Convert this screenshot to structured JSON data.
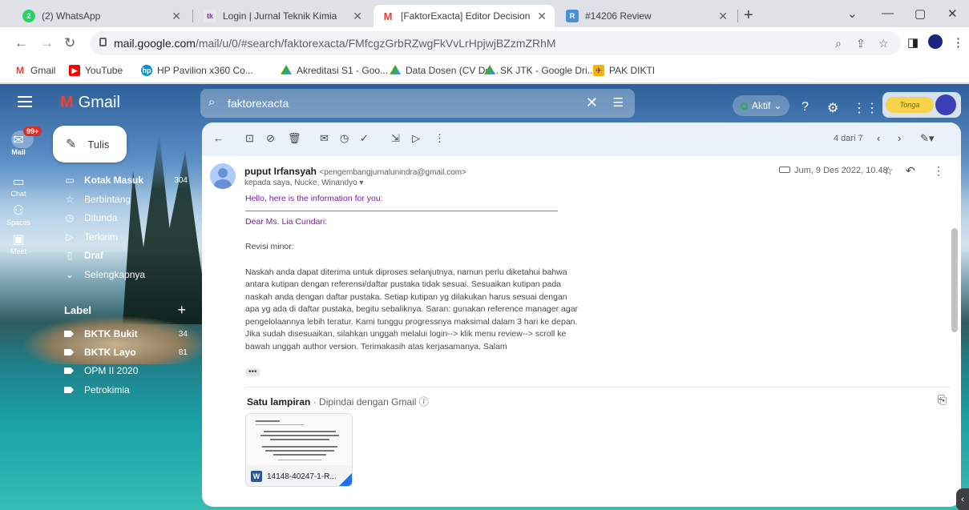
{
  "browser": {
    "tabs": [
      {
        "title": "(2) WhatsApp",
        "icon": "whatsapp-icon",
        "favicon_text": "2"
      },
      {
        "title": "Login | Jurnal Teknik Kimia",
        "icon": "journal-icon",
        "favicon_text": "tk"
      },
      {
        "title": "[FaktorExacta] Editor Decision - I",
        "icon": "gmail-icon",
        "favicon_text": "M"
      },
      {
        "title": "#14206 Review",
        "icon": "review-icon",
        "favicon_text": "R"
      }
    ],
    "new_tab": "+",
    "url_host": "mail.google.com",
    "url_path": "/mail/u/0/#search/faktorexacta/FMfcgzGrbRZwgFkVvLrHpjwjBZzmZRhM",
    "bookmarks": [
      {
        "label": "Gmail",
        "icon": "gmail-icon"
      },
      {
        "label": "YouTube",
        "icon": "youtube-icon"
      },
      {
        "label": "HP Pavilion x360 Co...",
        "icon": "hp-icon"
      },
      {
        "label": "Akreditasi S1 - Goo...",
        "icon": "google-drive-icon"
      },
      {
        "label": "Data Dosen (CV Do...",
        "icon": "google-drive-icon"
      },
      {
        "label": "SK JTK - Google Dri...",
        "icon": "google-drive-icon"
      },
      {
        "label": "PAK DIKTI",
        "icon": "pak-dikti-icon"
      }
    ]
  },
  "gmail": {
    "app_name": "Gmail",
    "search_query": "faktorexacta",
    "status_label": "Aktif",
    "account_badge": "Tonga",
    "avatar_initial": "",
    "rail": [
      {
        "label": "Mail",
        "badge": "99+"
      },
      {
        "label": "Chat"
      },
      {
        "label": "Spaces"
      },
      {
        "label": "Meet"
      }
    ],
    "compose_label": "Tulis",
    "nav": [
      {
        "label": "Kotak Masuk",
        "count": "304",
        "bold": true
      },
      {
        "label": "Berbintang",
        "count": ""
      },
      {
        "label": "Ditunda",
        "count": ""
      },
      {
        "label": "Terkirim",
        "count": ""
      },
      {
        "label": "Draf",
        "count": ""
      },
      {
        "label": "Selengkapnya",
        "count": ""
      }
    ],
    "labels_header": "Label",
    "labels": [
      {
        "label": "BKTK Bukit",
        "count": "34",
        "bold": true
      },
      {
        "label": "BKTK Layo",
        "count": "81",
        "bold": true
      },
      {
        "label": "OPM II 2020",
        "count": ""
      },
      {
        "label": "Petrokimia",
        "count": ""
      }
    ],
    "pager": "4 dari 7"
  },
  "message": {
    "sender_name": "puput Irfansyah",
    "sender_email": "<pengembangjurnalunindra@gmail.com>",
    "recipients": "kepada saya, Nucke, Winandyo",
    "date": "Jum, 9 Des 2022, 10.48",
    "intro": "Hello, here is the information for you:",
    "greeting": "Dear Ms. Lia Cundari:",
    "revision": "Revisi minor:",
    "paragraph": "Naskah anda dapat diterima untuk diproses selanjutnya, namun perlu diketahui bahwa antara kutipan dengan referensi/daftar pustaka tidak sesuai. Sesuaikan kutipan pada naskah anda dengan daftar pustaka. Setiap kutipan yg dilakukan harus sesuai dengan apa yg ada di daftar pustaka, begitu sebaliknya. Saran: gunakan reference manager agar pengelolaannya lebih teratur. Kami tunggu progressnya maksimal dalam 3 hari ke depan. Jika sudah disesuaikan, silahkan unggah melalui login--> klik menu review--> scroll ke bawah unggah author version. Terimakasih atas kerjasamanya. Salam",
    "more": "•••",
    "attachment_header": "Satu lampiran",
    "attachment_scan": "Dipindai dengan Gmail",
    "attachment_name": "14148-40247-1-R...",
    "attachment_type": "W"
  },
  "colors": {
    "gmail_red": "#ea4335",
    "badge_red": "#d93025",
    "body_purple": "#7a1fa2",
    "word_blue": "#2b579a"
  }
}
